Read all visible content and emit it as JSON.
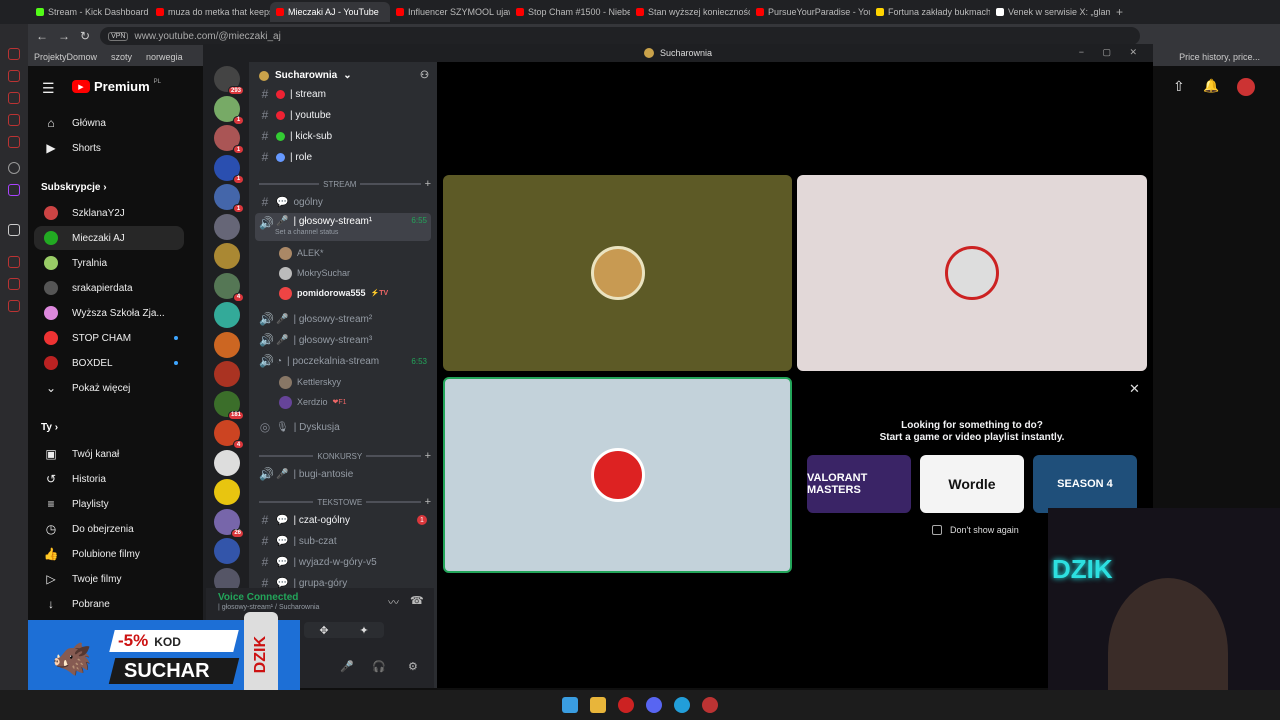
{
  "browser": {
    "tabs": [
      {
        "label": "Stream - Kick Dashboard",
        "color": "#53fc18",
        "active": false
      },
      {
        "label": "muza do metka that keeps",
        "color": "#ff0000",
        "active": false
      },
      {
        "label": "Mieczaki AJ - YouTube",
        "color": "#ff0000",
        "active": true
      },
      {
        "label": "Influencer SZYMOOL ujaw",
        "color": "#ff0000",
        "active": false
      },
      {
        "label": "Stop Cham #1500 - Niebez",
        "color": "#ff0000",
        "active": false
      },
      {
        "label": "Stan wyższej konieczności",
        "color": "#ff0000",
        "active": false
      },
      {
        "label": "PursueYourParadise - YouT",
        "color": "#ff0000",
        "active": false
      },
      {
        "label": "Fortuna zakłady bukmache",
        "color": "#ffd400",
        "active": false
      },
      {
        "label": "Venek w serwisie X: „glam",
        "color": "#ffffff",
        "active": false
      }
    ],
    "vpn": "VPN",
    "url": "www.youtube.com/@mieczaki_aj",
    "bookmarks": [
      "ProjektyDomow",
      "szoty",
      "norwegia"
    ],
    "price_history": "Price history, price..."
  },
  "youtube": {
    "logo": "Premium",
    "logo_sup": "PL",
    "nav": [
      {
        "label": "Główna",
        "icon": "home-icon",
        "glyph": "⌂"
      },
      {
        "label": "Shorts",
        "icon": "shorts-icon",
        "glyph": "▶"
      }
    ],
    "subscriptions_title": "Subskrypcje",
    "subscriptions": [
      {
        "label": "SzklanaY2J",
        "color": "#c44"
      },
      {
        "label": "Mieczaki AJ",
        "color": "#2a2",
        "selected": true
      },
      {
        "label": "Tyralnia",
        "color": "#9c6"
      },
      {
        "label": "srakapierdata",
        "color": "#555"
      },
      {
        "label": "Wyższa Szkoła Zja...",
        "color": "#d8d"
      },
      {
        "label": "STOP CHAM",
        "color": "#e33",
        "dot": true
      },
      {
        "label": "BOXDEL",
        "color": "#b22",
        "dot": true
      }
    ],
    "show_more": "Pokaż więcej",
    "you_title": "Ty",
    "you_items": [
      {
        "label": "Twój kanał",
        "glyph": "▣"
      },
      {
        "label": "Historia",
        "glyph": "↺"
      },
      {
        "label": "Playlisty",
        "glyph": "≡"
      },
      {
        "label": "Do obejrzenia",
        "glyph": "◷"
      },
      {
        "label": "Polubione filmy",
        "glyph": "👍"
      },
      {
        "label": "Twoje filmy",
        "glyph": "▷"
      },
      {
        "label": "Pobrane",
        "glyph": "↓"
      }
    ]
  },
  "discord": {
    "window_title": "Sucharownia",
    "server_name": "Sucharownia",
    "server_badges": [
      "293",
      "1",
      "1",
      "1",
      "1",
      "",
      "",
      "4",
      "",
      "",
      "",
      "181",
      "4",
      "",
      "",
      "26",
      "",
      "NEW"
    ],
    "channels_top": [
      {
        "label": "stream",
        "color": "#e23"
      },
      {
        "label": "youtube",
        "color": "#e23"
      },
      {
        "label": "kick-sub",
        "color": "#3c3"
      },
      {
        "label": "role",
        "color": "#69f"
      }
    ],
    "category_stream": "STREAM",
    "general": "ogólny",
    "voice_active": "głosowy-stream¹",
    "voice_active_time": "6:55",
    "channel_status": "Set a channel status",
    "members_1": [
      {
        "label": "ALEK*",
        "color": "#a86"
      },
      {
        "label": "MokrySuchar",
        "color": "#bbb"
      },
      {
        "label": "pomidorowa555",
        "color": "#e44",
        "tag": "⚡TV",
        "bright": true
      }
    ],
    "voice_2": "głosowy-stream²",
    "voice_3": "głosowy-stream³",
    "waiting_room": "poczekalnia-stream",
    "waiting_time": "6:53",
    "members_2": [
      {
        "label": "Kettlerskyy",
        "color": "#876"
      },
      {
        "label": "Xerdzio",
        "color": "#649",
        "tag": "❤F1"
      }
    ],
    "stage": "Dyskusja",
    "category_contests": "KONKURSY",
    "contest_channel": "bugi-antosie",
    "category_text": "TEKSTOWE",
    "text_channels": [
      {
        "label": "czat-ogólny",
        "bright": true,
        "badge": "1"
      },
      {
        "label": "sub-czat"
      },
      {
        "label": "wyjazd-w-góry-v5"
      },
      {
        "label": "grupa-góry"
      }
    ],
    "voice_connected": "Voice Connected",
    "voice_location": "| głosowy-stream¹ / Sucharownia",
    "activity_prompt_1": "Looking for something to do?",
    "activity_prompt_2": "Start a game or video playlist instantly.",
    "games": [
      {
        "label": "VALORANT MASTERS",
        "color": "#3a2466"
      },
      {
        "label": "Wordle",
        "color": "#f4f4f4"
      },
      {
        "label": "SEASON 4",
        "color": "#1f4f7a"
      }
    ],
    "dont_show": "Don't show again"
  },
  "promo": {
    "discount": "-5%",
    "code_label": "KOD",
    "code": "SUCHAR",
    "brand": "DZIK"
  },
  "stream_overlay": {
    "logo": "DZIK"
  }
}
